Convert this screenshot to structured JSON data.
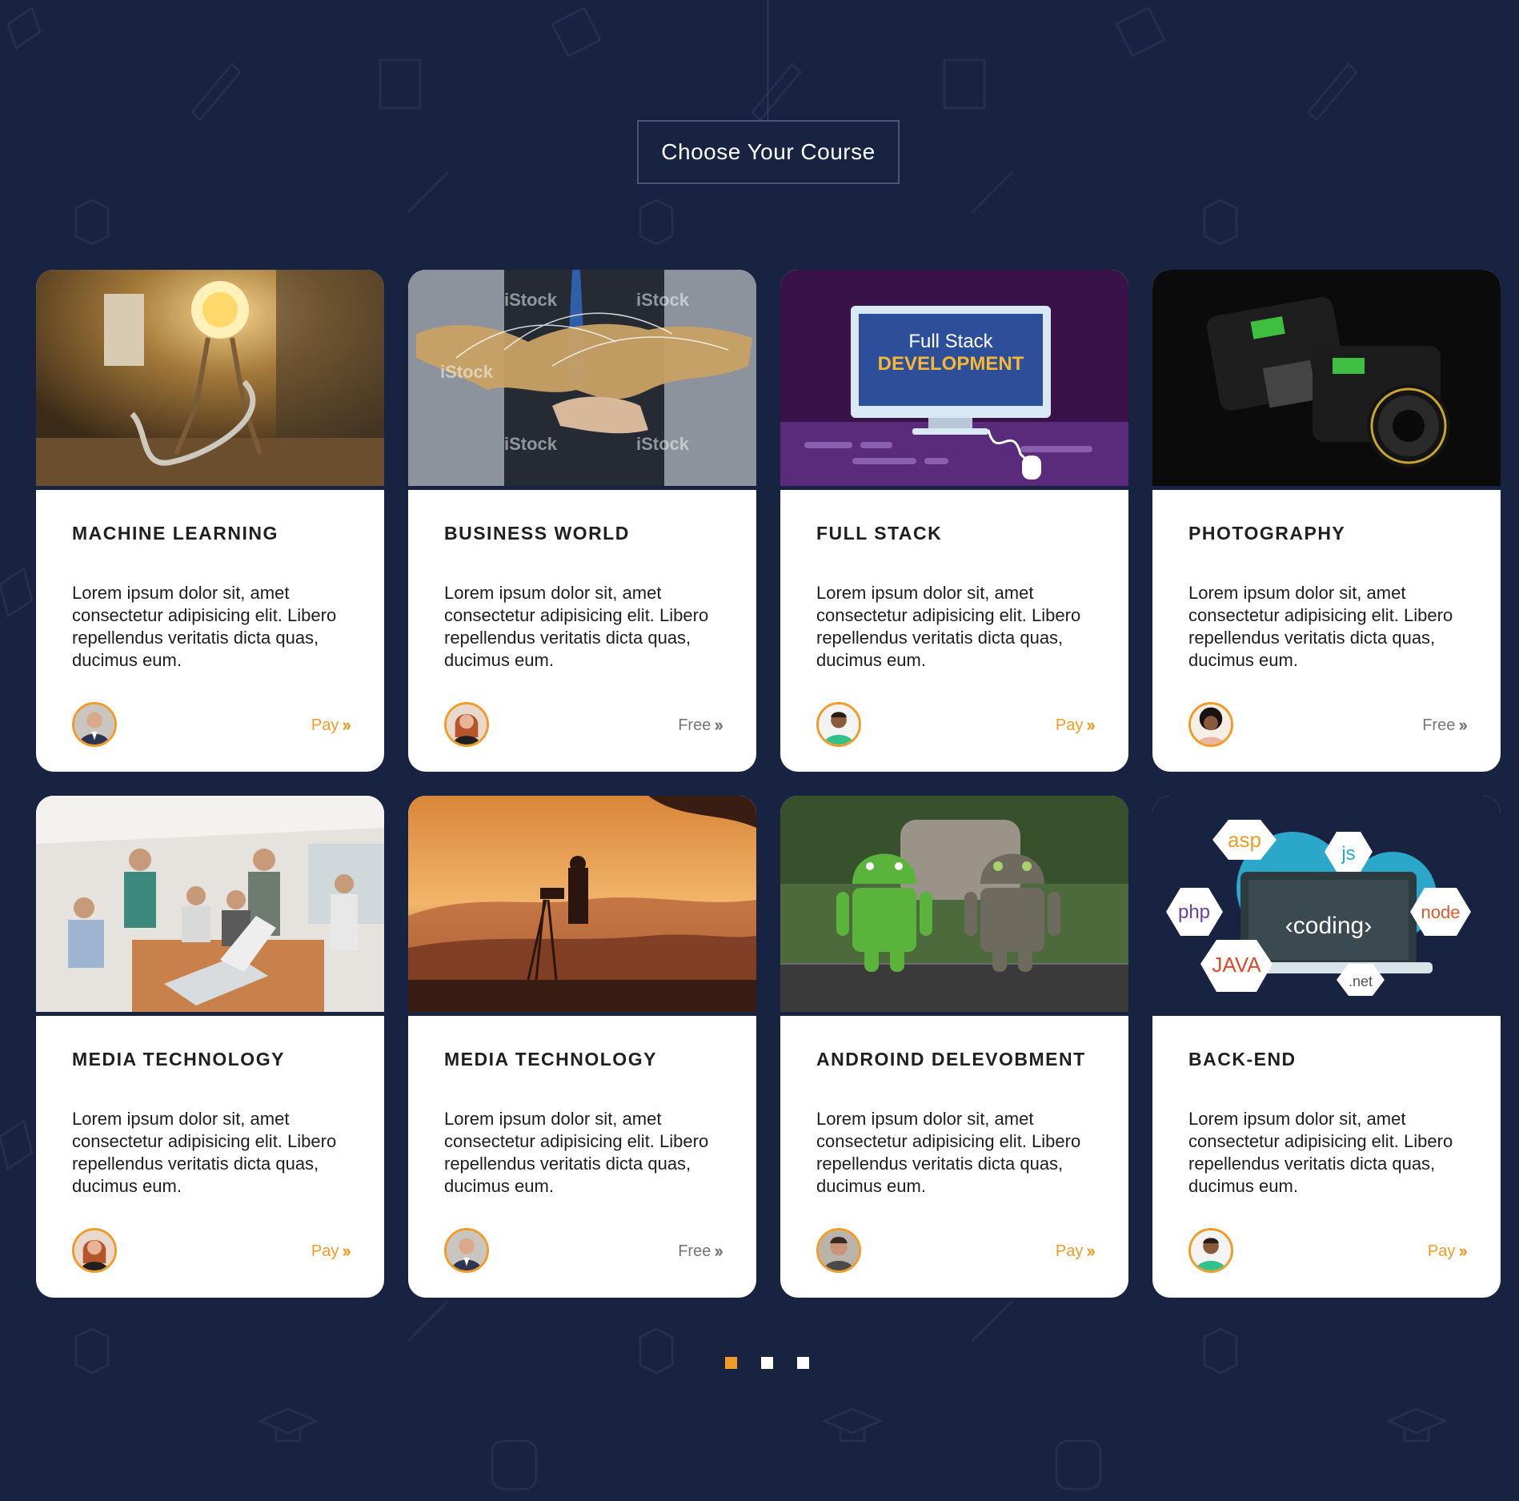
{
  "section": {
    "title": "Choose Your Course"
  },
  "colors": {
    "background": "#182241",
    "accent": "#f19c28",
    "card": "#ffffff",
    "muted_price": "#777777"
  },
  "courses": [
    {
      "title": "MACHINE LEARNING",
      "description": "Lorem ipsum dolor sit, amet consectetur adipisicing elit. Libero repellendus veritatis dicta quas, ducimus eum.",
      "price_label": "Pay",
      "price_type": "pay",
      "image": "light-bulb",
      "avatar": "man-suit"
    },
    {
      "title": "BUSINESS WORLD",
      "description": "Lorem ipsum dolor sit, amet consectetur adipisicing elit. Libero repellendus veritatis dicta quas, ducimus eum.",
      "price_label": "Free",
      "price_type": "free",
      "image": "world-map-business",
      "avatar": "woman-smiling"
    },
    {
      "title": "FULL STACK",
      "description": "Lorem ipsum dolor sit, amet consectetur adipisicing elit. Libero repellendus veritatis dicta quas, ducimus eum.",
      "price_label": "Pay",
      "price_type": "pay",
      "image": "full-stack-monitor",
      "avatar": "man-green-shirt"
    },
    {
      "title": "PHOTOGRAPHY",
      "description": "Lorem ipsum dolor sit, amet consectetur adipisicing elit. Libero repellendus veritatis dicta quas, ducimus eum.",
      "price_label": "Free",
      "price_type": "free",
      "image": "cameras",
      "avatar": "woman-curly-hair"
    },
    {
      "title": "MEDIA TECHNOLOGY",
      "description": "Lorem ipsum dolor sit, amet consectetur adipisicing elit. Libero repellendus veritatis dicta quas, ducimus eum.",
      "price_label": "Pay",
      "price_type": "pay",
      "image": "team-laptops",
      "avatar": "woman-smiling"
    },
    {
      "title": "MEDIA TECHNOLOGY",
      "description": "Lorem ipsum dolor sit, amet consectetur adipisicing elit. Libero repellendus veritatis dicta quas, ducimus eum.",
      "price_label": "Free",
      "price_type": "free",
      "image": "sunset-photographer",
      "avatar": "man-suit"
    },
    {
      "title": "ANDROIND DELEVOBMENT",
      "description": "Lorem ipsum dolor sit, amet consectetur adipisicing elit. Libero repellendus veritatis dicta quas, ducimus eum.",
      "price_label": "Pay",
      "price_type": "pay",
      "image": "android-robots",
      "avatar": "man-stubble"
    },
    {
      "title": "BACK-END",
      "description": "Lorem ipsum dolor sit, amet consectetur adipisicing elit. Libero repellendus veritatis dicta quas, ducimus eum.",
      "price_label": "Pay",
      "price_type": "pay",
      "image": "coding-languages",
      "avatar": "man-green-shirt"
    }
  ],
  "pagination": {
    "pages": 3,
    "active": 1
  },
  "image_text": {
    "full_stack_line1": "Full Stack",
    "full_stack_line2": "DEVELOPMENT",
    "istock": "iStock",
    "coding": "‹coding›",
    "asp": "asp",
    "js": "js",
    "php": "php",
    "node": "node",
    "java": "JAVA",
    "net": ".net"
  }
}
